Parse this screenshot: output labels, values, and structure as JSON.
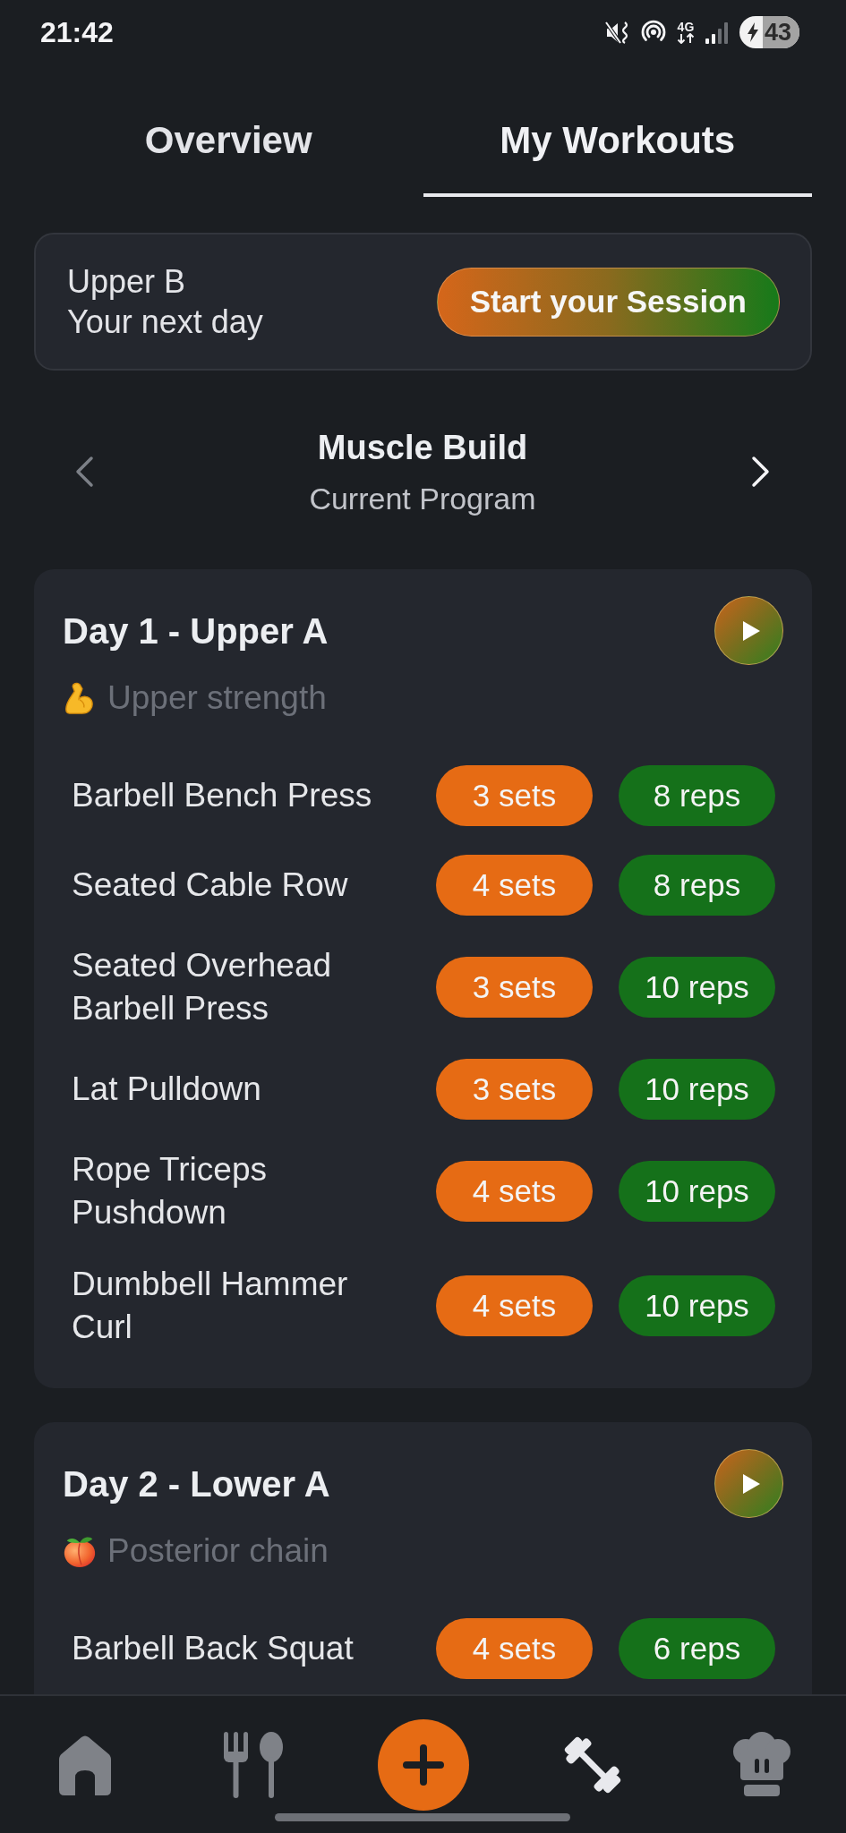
{
  "status_bar": {
    "time": "21:42",
    "network": "4G",
    "battery": "43"
  },
  "tabs": [
    {
      "label": "Overview",
      "selected": false
    },
    {
      "label": "My Workouts",
      "selected": true
    }
  ],
  "next_session": {
    "title": "Upper B",
    "subtitle": "Your next day",
    "button": "Start your Session"
  },
  "program": {
    "name": "Muscle Build",
    "caption": "Current Program",
    "previous_disabled": true,
    "next_disabled": false
  },
  "days": [
    {
      "title": "Day 1 - Upper A",
      "kind": "biceps",
      "focus": "Upper strength",
      "exercises": [
        {
          "name": "Barbell Bench Press",
          "sets": "3 sets",
          "reps": "8 reps"
        },
        {
          "name": "Seated Cable Row",
          "sets": "4 sets",
          "reps": "8 reps"
        },
        {
          "name": "Seated Overhead Barbell Press",
          "sets": "3 sets",
          "reps": "10 reps"
        },
        {
          "name": "Lat Pulldown",
          "sets": "3 sets",
          "reps": "10 reps"
        },
        {
          "name": "Rope Triceps Pushdown",
          "sets": "4 sets",
          "reps": "10 reps"
        },
        {
          "name": "Dumbbell Hammer Curl",
          "sets": "4 sets",
          "reps": "10 reps"
        }
      ]
    },
    {
      "title": "Day 2 - Lower A",
      "kind": "peach",
      "focus": "Posterior chain",
      "exercises": [
        {
          "name": "Barbell Back Squat",
          "sets": "4 sets",
          "reps": "6 reps"
        }
      ]
    }
  ],
  "bottom_nav": [
    {
      "kind": "home",
      "selected": false
    },
    {
      "kind": "meals",
      "selected": false
    },
    {
      "kind": "add",
      "selected": false
    },
    {
      "kind": "workouts",
      "selected": true
    },
    {
      "kind": "chef",
      "selected": false
    }
  ]
}
